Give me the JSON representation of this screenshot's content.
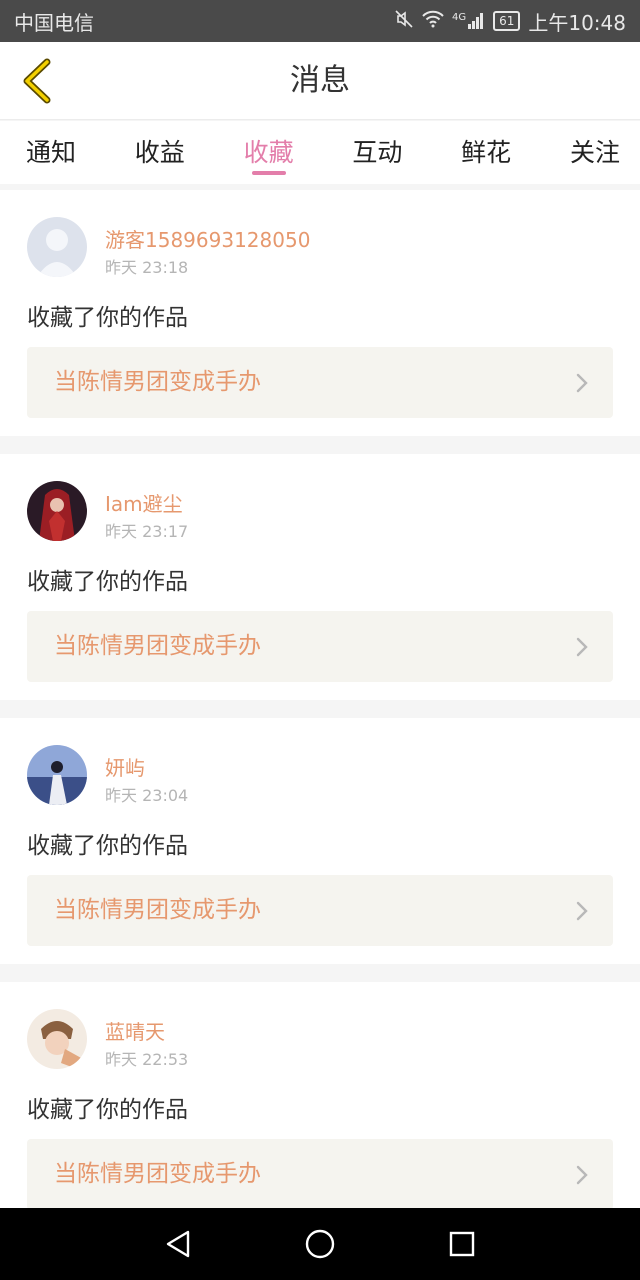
{
  "status_bar": {
    "carrier": "中国电信",
    "network": "4G",
    "battery": "61",
    "time": "上午10:48"
  },
  "header": {
    "title": "消息"
  },
  "tabs": [
    {
      "label": "通知",
      "active": false
    },
    {
      "label": "收益",
      "active": false
    },
    {
      "label": "收藏",
      "active": true
    },
    {
      "label": "互动",
      "active": false
    },
    {
      "label": "鲜花",
      "active": false
    },
    {
      "label": "关注",
      "active": false
    }
  ],
  "messages": [
    {
      "username": "游客1589693128050",
      "time": "昨天 23:18",
      "action": "收藏了你的作品",
      "work_title": "当陈情男团变成手办"
    },
    {
      "username": "Iam避尘",
      "time": "昨天 23:17",
      "action": "收藏了你的作品",
      "work_title": "当陈情男团变成手办"
    },
    {
      "username": "妍屿",
      "time": "昨天 23:04",
      "action": "收藏了你的作品",
      "work_title": "当陈情男团变成手办"
    },
    {
      "username": "蓝晴天",
      "time": "昨天 22:53",
      "action": "收藏了你的作品",
      "work_title": "当陈情男团变成手办"
    }
  ],
  "colors": {
    "accent_pink": "#e37eaa",
    "username_orange": "#e6986e",
    "back_arrow": "#c8a400"
  },
  "icons": {
    "back": "chevron-left-icon",
    "row_arrow": "chevron-right-icon",
    "nav_back": "triangle-back-icon",
    "nav_home": "circle-home-icon",
    "nav_recent": "square-recent-icon"
  }
}
